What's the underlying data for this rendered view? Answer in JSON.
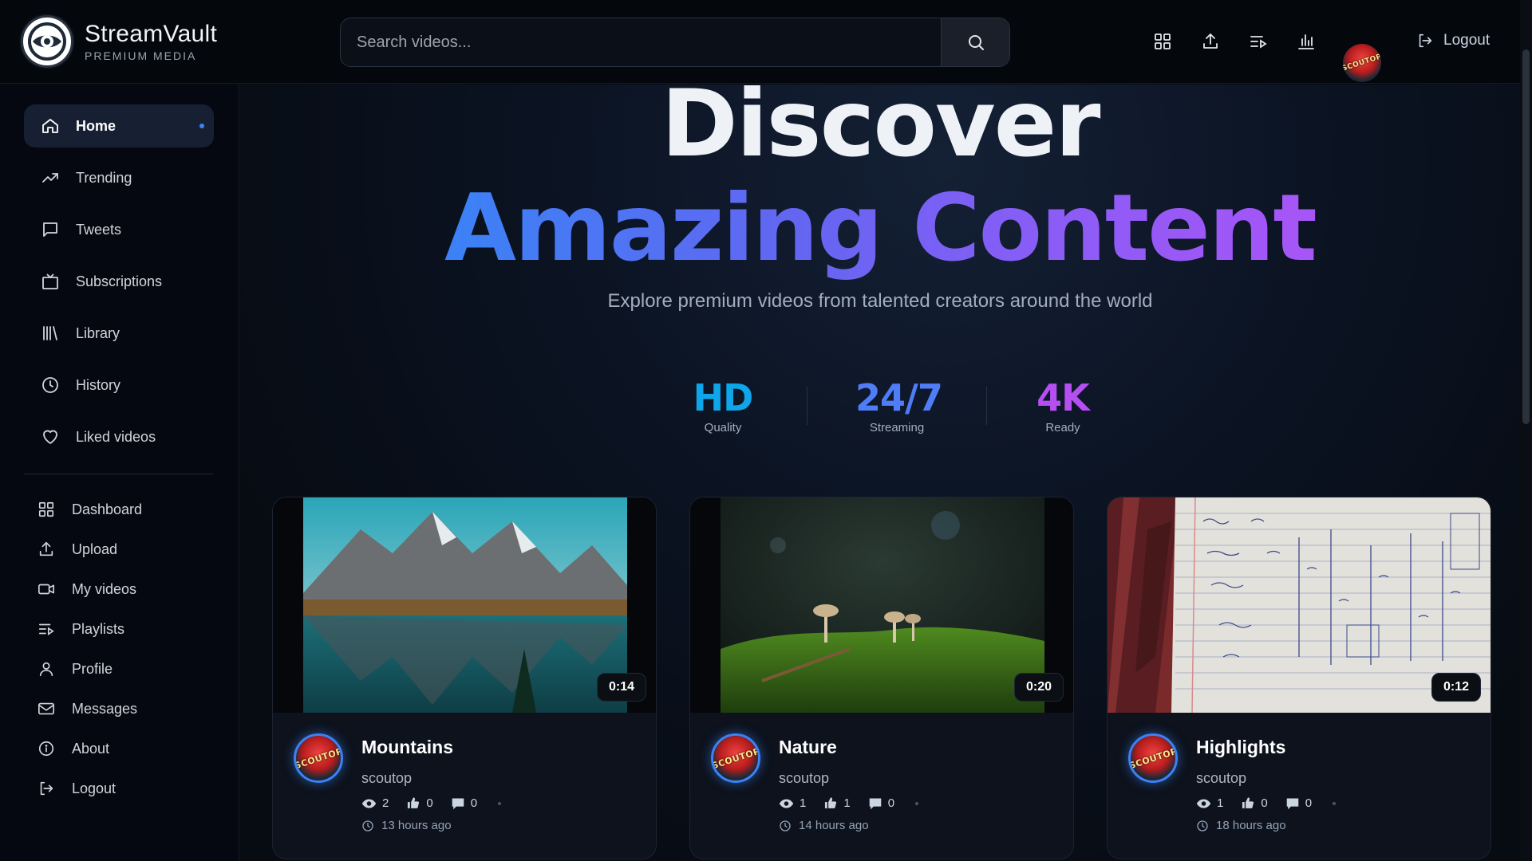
{
  "app": {
    "name": "StreamVault",
    "tagline": "PREMIUM MEDIA"
  },
  "search": {
    "placeholder": "Search videos..."
  },
  "header": {
    "icons": [
      "dashboard-icon",
      "upload-icon",
      "playlists-icon",
      "stats-icon"
    ],
    "avatar_text": "SCOUTOP",
    "logout_label": "Logout"
  },
  "sidebar": {
    "main": [
      {
        "label": "Home",
        "icon": "home-icon",
        "active": true
      },
      {
        "label": "Trending",
        "icon": "trending-icon"
      },
      {
        "label": "Tweets",
        "icon": "tweets-icon"
      },
      {
        "label": "Subscriptions",
        "icon": "subscriptions-icon"
      },
      {
        "label": "Library",
        "icon": "library-icon"
      },
      {
        "label": "History",
        "icon": "history-icon"
      },
      {
        "label": "Liked videos",
        "icon": "heart-icon"
      }
    ],
    "secondary": [
      {
        "label": "Dashboard",
        "icon": "dashboard-icon"
      },
      {
        "label": "Upload",
        "icon": "upload-icon"
      },
      {
        "label": "My videos",
        "icon": "video-camera-icon"
      },
      {
        "label": "Playlists",
        "icon": "playlists-icon"
      },
      {
        "label": "Profile",
        "icon": "user-icon"
      },
      {
        "label": "Messages",
        "icon": "mail-icon"
      },
      {
        "label": "About",
        "icon": "info-icon"
      },
      {
        "label": "Logout",
        "icon": "logout-icon"
      }
    ]
  },
  "hero": {
    "line1": "Discover",
    "line2": "Amazing Content",
    "subtitle": "Explore premium videos from talented creators around the world"
  },
  "stats": [
    {
      "value": "HD",
      "label": "Quality",
      "color": "#0ea5e9"
    },
    {
      "value": "24/7",
      "label": "Streaming",
      "color": "#4f7cf7"
    },
    {
      "value": "4K",
      "label": "Ready",
      "color": "#b64ff2"
    }
  ],
  "videos": [
    {
      "title": "Mountains",
      "channel": "scoutop",
      "duration": "0:14",
      "views": "2",
      "likes": "0",
      "comments": "0",
      "time": "13 hours ago"
    },
    {
      "title": "Nature",
      "channel": "scoutop",
      "duration": "0:20",
      "views": "1",
      "likes": "1",
      "comments": "0",
      "time": "14 hours ago"
    },
    {
      "title": "Highlights",
      "channel": "scoutop",
      "duration": "0:12",
      "views": "1",
      "likes": "0",
      "comments": "0",
      "time": "18 hours ago"
    }
  ],
  "colors": {
    "accent": "#3b82f6",
    "background": "#070b12",
    "active_nav": "#172033"
  }
}
